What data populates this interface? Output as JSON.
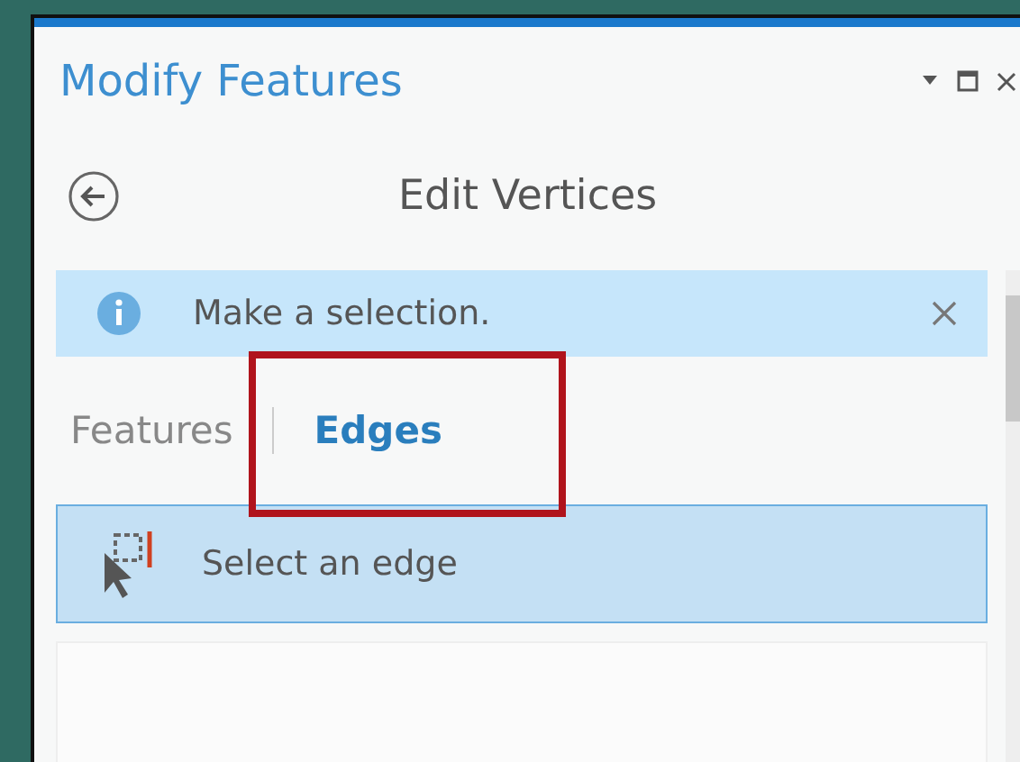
{
  "pane": {
    "title": "Modify Features"
  },
  "header": {
    "title": "Edit Vertices"
  },
  "message": {
    "text": "Make a selection."
  },
  "tabs": [
    {
      "label": "Features",
      "selected": false,
      "highlighted": false
    },
    {
      "label": "Edges",
      "selected": true,
      "highlighted": true
    }
  ],
  "tools": [
    {
      "label": "Select an edge",
      "selected": true
    }
  ]
}
